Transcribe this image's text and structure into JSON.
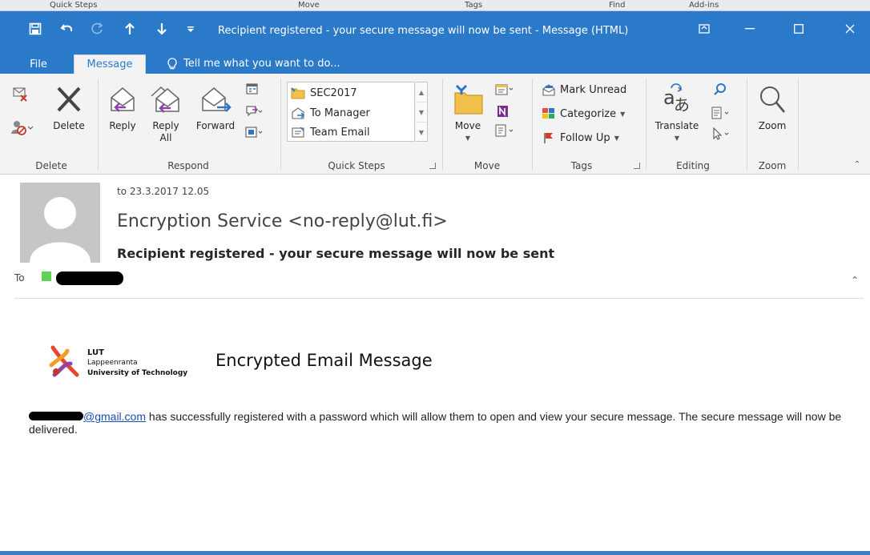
{
  "behind_window": {
    "labels": [
      "Quick Steps",
      "Move",
      "Tags",
      "Find",
      "Add-ins"
    ]
  },
  "titlebar": {
    "title": "Recipient registered - your secure message will now be sent - Message (HTML)",
    "accent": "#2b79c9"
  },
  "tabs": {
    "file": "File",
    "message": "Message",
    "tell_me": "Tell me what you want to do..."
  },
  "ribbon": {
    "delete_group": {
      "label": "Delete",
      "delete_button": "Delete"
    },
    "respond_group": {
      "label": "Respond",
      "reply": "Reply",
      "reply_all_line1": "Reply",
      "reply_all_line2": "All",
      "forward": "Forward"
    },
    "quick_steps_group": {
      "label": "Quick Steps",
      "items": [
        "SEC2017",
        "To Manager",
        "Team Email"
      ]
    },
    "move_group": {
      "label": "Move",
      "move_button": "Move"
    },
    "tags_group": {
      "label": "Tags",
      "mark_unread": "Mark Unread",
      "categorize": "Categorize",
      "follow_up": "Follow Up"
    },
    "editing_group": {
      "label": "Editing",
      "translate": "Translate"
    },
    "zoom_group": {
      "label": "Zoom",
      "zoom_button": "Zoom"
    }
  },
  "header": {
    "date": "to 23.3.2017 12.05",
    "sender": "Encryption Service <no-reply@lut.fi>",
    "subject": "Recipient registered - your secure message will now be sent",
    "to_label": "To"
  },
  "body": {
    "logo": {
      "line1": "LUT",
      "line2": "Lappeenranta",
      "line3": "University of Technology"
    },
    "heading": "Encrypted Email Message",
    "email_link_domain": "@gmail.com",
    "message_text": " has successfully registered with a password which will allow them to open and view your secure message. The secure message will now be delivered."
  }
}
